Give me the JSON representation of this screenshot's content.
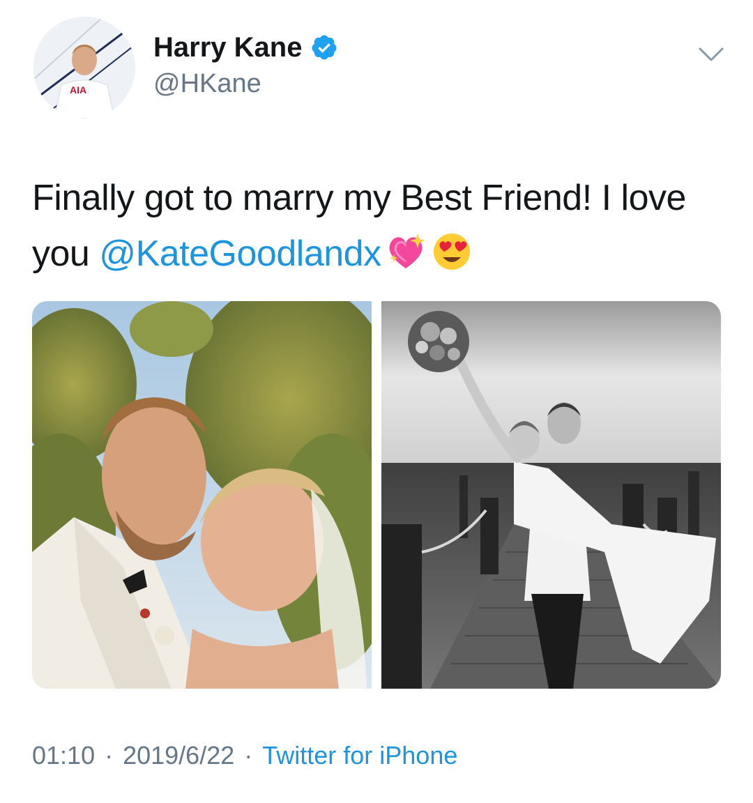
{
  "header": {
    "display_name": "Harry Kane",
    "handle": "@HKane",
    "avatar_icon": "profile-photo",
    "avatar_jersey_text": "AIA",
    "verified_icon": "verified-badge-icon",
    "menu_icon": "chevron-down-icon"
  },
  "tweet": {
    "text_before": "Finally got to marry my Best Friend! I love you ",
    "mention": "@KateGoodlandx",
    "emojis": [
      "sparkling-heart-emoji",
      "heart-eyes-emoji"
    ]
  },
  "media": [
    {
      "name": "wedding-photo-color",
      "description_icon": "photo"
    },
    {
      "name": "wedding-photo-bw",
      "description_icon": "photo"
    }
  ],
  "meta": {
    "time": "01:10",
    "separator": "·",
    "date": "2019/6/22",
    "source": "Twitter for iPhone"
  },
  "colors": {
    "text_primary": "#14171a",
    "text_secondary": "#657786",
    "link": "#1b95e0",
    "verified": "#1da1f2"
  }
}
